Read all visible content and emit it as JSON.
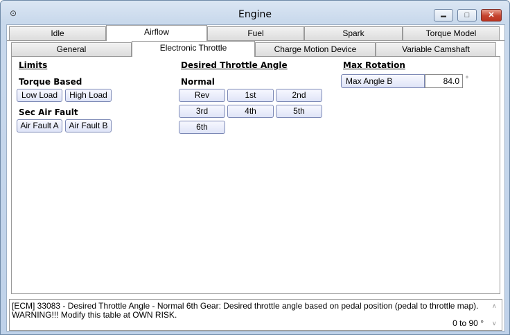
{
  "window": {
    "title": "Engine",
    "app_icon": "gauge-icon",
    "minimize_glyph": "▬",
    "maximize_glyph": "□",
    "close_glyph": "✕"
  },
  "tabs_top": [
    {
      "label": "Idle",
      "active": false
    },
    {
      "label": "Airflow",
      "active": true
    },
    {
      "label": "Fuel",
      "active": false
    },
    {
      "label": "Spark",
      "active": false
    },
    {
      "label": "Torque Model",
      "active": false
    }
  ],
  "tabs_sub": [
    {
      "label": "General",
      "active": false
    },
    {
      "label": "Electronic Throttle",
      "active": true
    },
    {
      "label": "Charge Motion Device",
      "active": false
    },
    {
      "label": "Variable Camshaft",
      "active": false
    }
  ],
  "limits": {
    "heading": "Limits",
    "torque_based": {
      "heading": "Torque Based",
      "buttons": [
        "Low Load",
        "High Load"
      ]
    },
    "sec_air_fault": {
      "heading": "Sec Air Fault",
      "buttons": [
        "Air Fault A",
        "Air Fault B"
      ]
    }
  },
  "desired_throttle": {
    "heading": "Desired Throttle Angle",
    "normal": {
      "heading": "Normal",
      "buttons": [
        "Rev",
        "1st",
        "2nd",
        "3rd",
        "4th",
        "5th",
        "6th"
      ]
    }
  },
  "max_rotation": {
    "heading": "Max Rotation",
    "field_label": "Max Angle B",
    "field_value": "84.0",
    "unit": "°"
  },
  "description": {
    "text": "[ECM] 33083 - Desired Throttle Angle - Normal 6th Gear: Desired throttle angle based on pedal position (pedal to throttle map). WARNING!!! Modify this table at OWN RISK.",
    "range": "0 to 90 °",
    "scroll_up": "∧",
    "scroll_down": "∨"
  }
}
